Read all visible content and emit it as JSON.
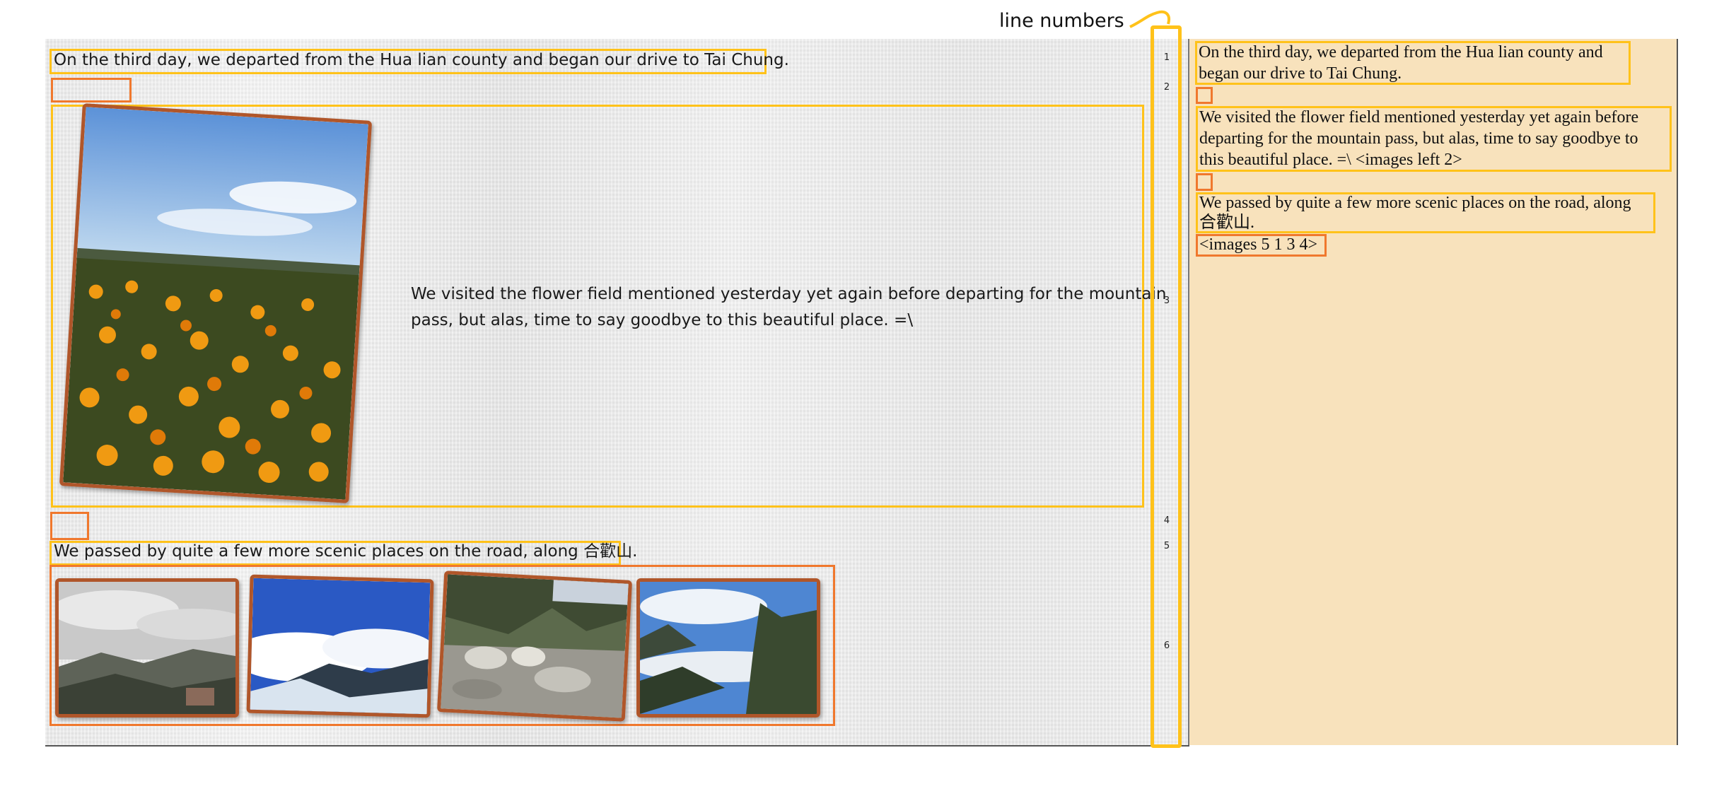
{
  "callout": {
    "label": "line numbers"
  },
  "colors": {
    "yellow_box": "#ffc21a",
    "orange_box": "#f0782d",
    "right_panel_bg": "#f8e2bc",
    "photo_frame": "#b0562a"
  },
  "left": {
    "line1": "On the third day, we departed from the Hua lian county and began our drive to Tai Chung.",
    "line3_a": "We visited the flower field mentioned yesterday yet again before departing for the mountain",
    "line3_b": "pass, but alas, time to say goodbye to this beautiful place. =\\",
    "line5": "We passed by quite a few more scenic places on the road, along 合歡山.",
    "photos": [
      {
        "name": "flower-field-photo"
      },
      {
        "name": "cloudy-mountain-photo"
      },
      {
        "name": "sea-of-clouds-photo"
      },
      {
        "name": "rocky-river-photo"
      },
      {
        "name": "cloud-valley-photo"
      }
    ]
  },
  "line_numbers": [
    "1",
    "2",
    "3",
    "4",
    "5",
    "6"
  ],
  "right": {
    "p1_a": "On the third day, we departed from the Hua lian county and",
    "p1_b": "began our drive to Tai Chung.",
    "p2_a": "We visited the flower field mentioned yesterday yet again before",
    "p2_b": "departing for the mountain pass, but alas, time to say goodbye to",
    "p2_c": "this beautiful place. =\\ <images left 2>",
    "p3_a": "We passed by quite a few more scenic places on the road, along",
    "p3_b": "合歡山.",
    "p4": "<images 5 1 3 4>"
  }
}
